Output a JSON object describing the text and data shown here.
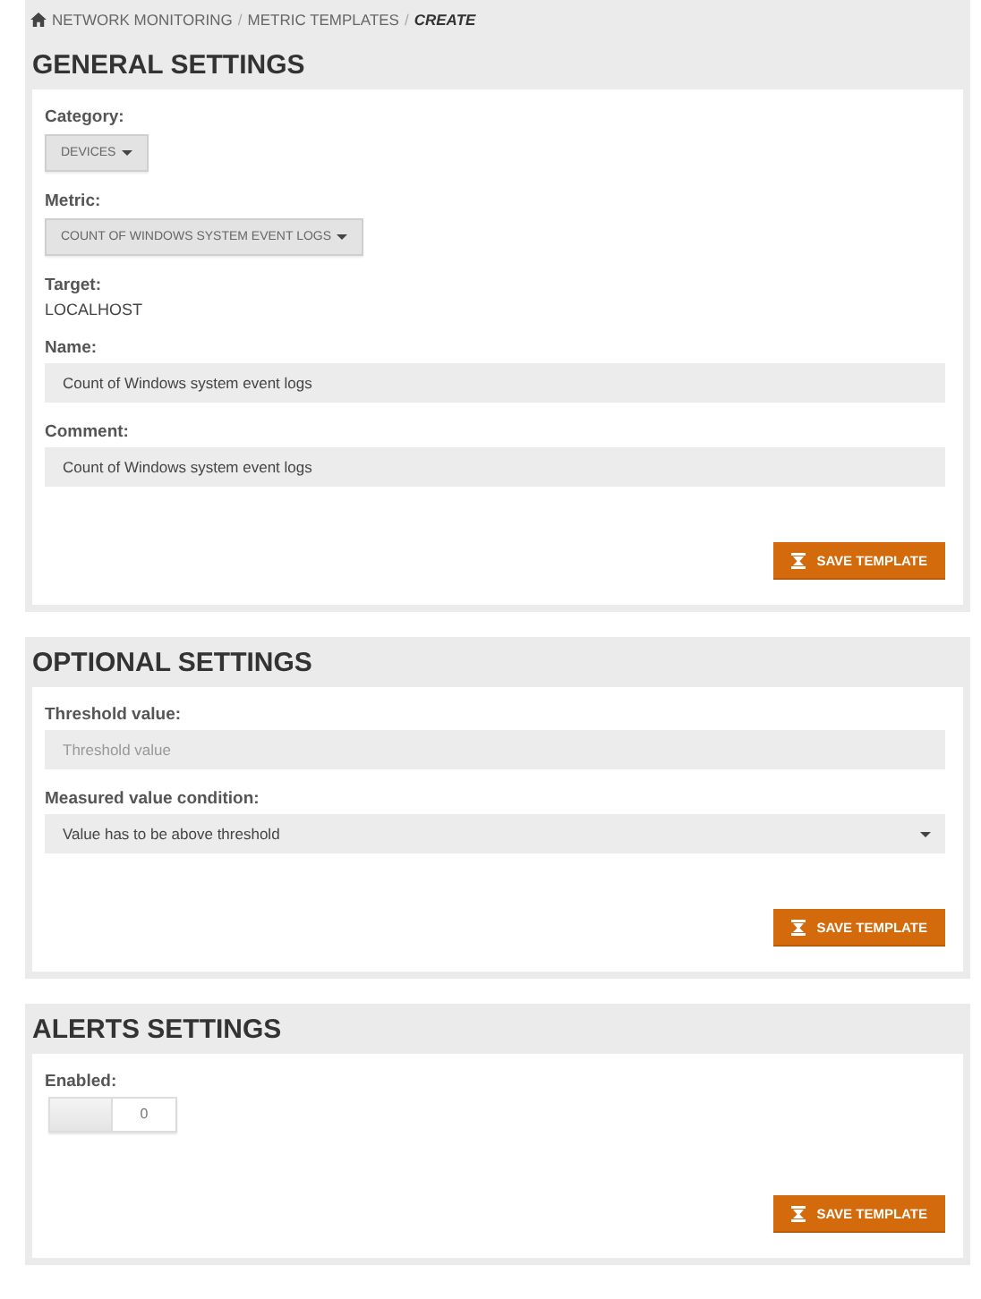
{
  "breadcrumb": {
    "separator": "/",
    "items": [
      {
        "label": "NETWORK MONITORING",
        "current": false
      },
      {
        "label": "METRIC TEMPLATES",
        "current": false
      },
      {
        "label": "CREATE",
        "current": true
      }
    ]
  },
  "sections": [
    {
      "title": "GENERAL SETTINGS",
      "fields": [
        {
          "kind": "dropdown",
          "label": "Category:",
          "value": "DEVICES"
        },
        {
          "kind": "dropdown",
          "label": "Metric:",
          "value": "COUNT OF WINDOWS SYSTEM EVENT LOGS"
        },
        {
          "kind": "text",
          "label": "Target:",
          "value": "LOCALHOST"
        },
        {
          "kind": "input",
          "label": "Name:",
          "value": "Count of Windows system event logs"
        },
        {
          "kind": "input",
          "label": "Comment:",
          "value": "Count of Windows system event logs"
        }
      ],
      "button": "SAVE TEMPLATE"
    },
    {
      "title": "OPTIONAL SETTINGS",
      "fields": [
        {
          "kind": "input",
          "label": "Threshold value:",
          "placeholder": "Threshold value"
        },
        {
          "kind": "select",
          "label": "Measured value condition:",
          "value": "Value has to be above threshold"
        }
      ],
      "button": "SAVE TEMPLATE"
    },
    {
      "title": "ALERTS SETTINGS",
      "fields": [
        {
          "kind": "toggle",
          "label": "Enabled:",
          "value": "0",
          "on": false
        }
      ],
      "button": "SAVE TEMPLATE"
    }
  ]
}
